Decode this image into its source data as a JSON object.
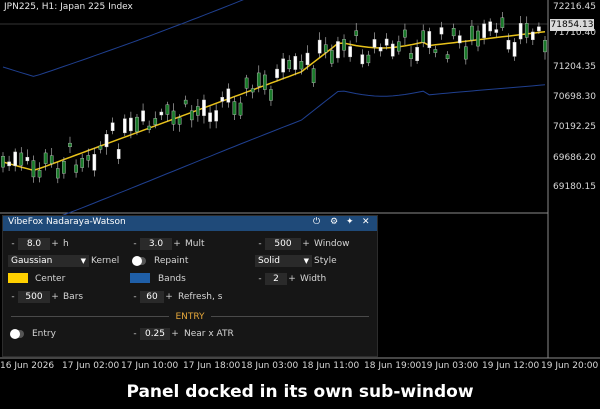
{
  "chart": {
    "symbol_title": "JPN225, H1:  Japan 225 Index",
    "current_price": "71854.13",
    "price_labels": [
      "72216.45",
      "71710.40",
      "71204.35",
      "70698.30",
      "70192.25",
      "69686.20",
      "69180.15"
    ],
    "time_labels": [
      "16 Jun 2026",
      "17 Jun 02:00",
      "17 Jun 10:00",
      "17 Jun 18:00",
      "18 Jun 03:00",
      "18 Jun 11:00",
      "18 Jun 19:00",
      "19 Jun 03:00",
      "19 Jun 12:00",
      "19 Jun 20:00"
    ],
    "colors": {
      "center_line": "#e8c21a",
      "bands": "#1f3f8f",
      "bull": "#ffffff",
      "bear": "#1a7a2a"
    }
  },
  "panel": {
    "title": "VibeFox Nadaraya-Watson",
    "header_icons": [
      "power-icon",
      "gear-icon",
      "pin-icon",
      "close-icon"
    ],
    "header_glyphs": [
      "⏻",
      "⚙",
      "✦",
      "✕"
    ],
    "h": {
      "value": "8.0",
      "label": "h"
    },
    "mult": {
      "value": "3.0",
      "label": "Mult"
    },
    "window": {
      "value": "500",
      "label": "Window"
    },
    "kernel": {
      "value": "Gaussian",
      "label": "Kernel"
    },
    "repaint": {
      "label": "Repaint",
      "on": false
    },
    "style": {
      "value": "Solid",
      "label": "Style"
    },
    "center": {
      "label": "Center",
      "color": "#ffd000"
    },
    "bands": {
      "label": "Bands",
      "color": "#1f5fa8"
    },
    "width": {
      "value": "2",
      "label": "Width"
    },
    "bars": {
      "value": "500",
      "label": "Bars"
    },
    "refresh": {
      "value": "60",
      "label": "Refresh, s"
    },
    "entry_header": "ENTRY",
    "entry": {
      "label": "Entry",
      "on": false
    },
    "near": {
      "value": "0.25",
      "label": "Near x ATR"
    },
    "minus": "-",
    "plus": "+"
  },
  "caption": "Panel docked in its own sub-window"
}
